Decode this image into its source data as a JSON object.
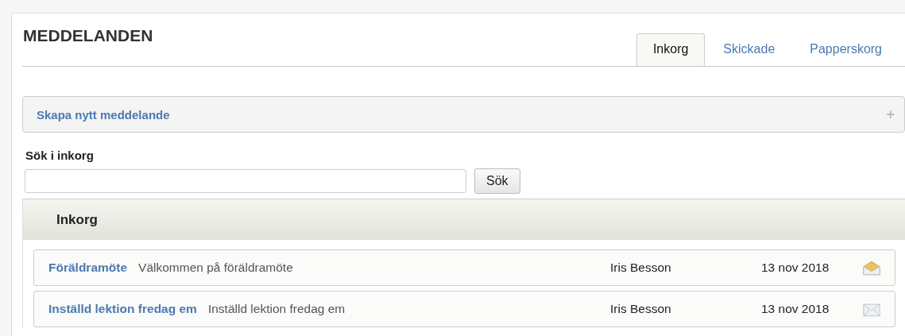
{
  "title": "MEDDELANDEN",
  "tabs": [
    {
      "label": "Inkorg",
      "selected": true
    },
    {
      "label": "Skickade",
      "selected": false
    },
    {
      "label": "Papperskorg",
      "selected": false
    }
  ],
  "create_panel": {
    "label": "Skapa nytt meddelande",
    "toggle": "+"
  },
  "search": {
    "label": "Sök i inkorg",
    "button": "Sök"
  },
  "inbox": {
    "heading": "Inkorg",
    "messages": [
      {
        "subject": "Föräldramöte",
        "preview": "Välkommen på föräldramöte",
        "sender": "Iris Besson",
        "date": "13 nov 2018",
        "opened": true
      },
      {
        "subject": "Inställd lektion fredag em",
        "preview": "Inställd lektion fredag em",
        "sender": "Iris Besson",
        "date": "13 nov 2018",
        "opened": false
      }
    ]
  }
}
